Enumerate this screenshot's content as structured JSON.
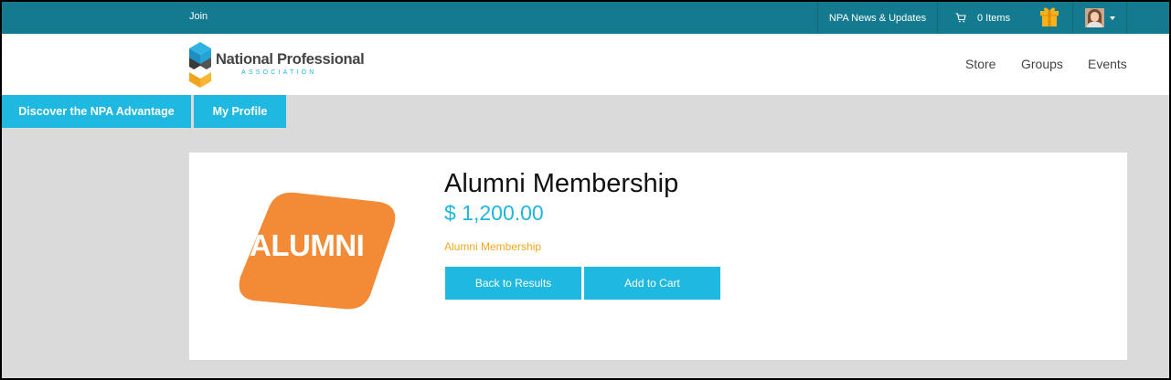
{
  "topbar": {
    "join_label": "Join",
    "news_label": "NPA News & Updates",
    "cart_label": "0 Items",
    "cart_icon": "cart-icon",
    "gift_icon": "gift-icon",
    "background": "#137a8f"
  },
  "header": {
    "logo_title": "National Professional",
    "logo_subtitle": "ASSOCIATION",
    "nav": [
      "Store",
      "Groups",
      "Events"
    ]
  },
  "tabs": [
    "Discover the NPA Advantage",
    "My Profile"
  ],
  "product": {
    "image_text": "ALUMNI",
    "title": "Alumni Membership",
    "price": "$ 1,200.00",
    "subtitle": "Alumni Membership",
    "back_label": "Back to Results",
    "add_label": "Add to Cart"
  },
  "colors": {
    "accent": "#1fb8e0",
    "orange": "#f28a36",
    "gold": "#f0a71e"
  }
}
